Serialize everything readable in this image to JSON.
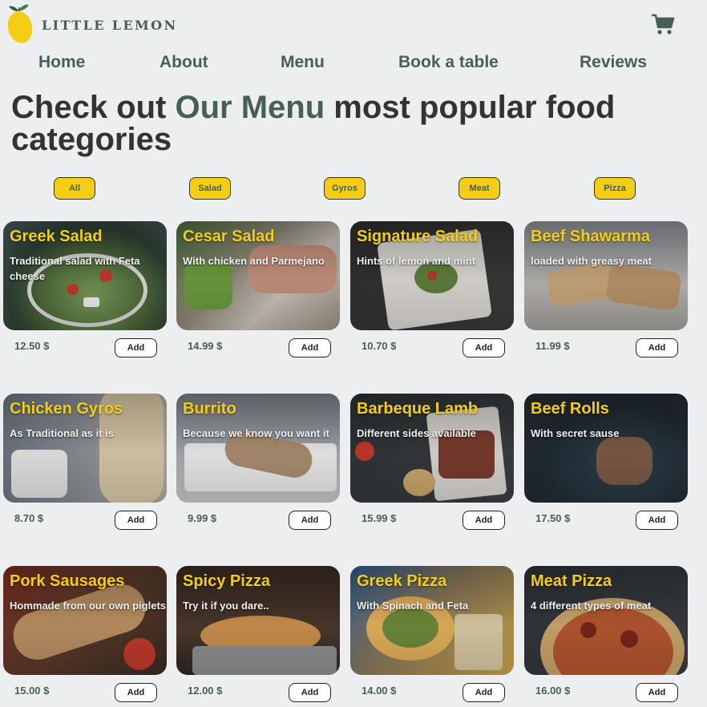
{
  "brand": {
    "name": "LITTLE LEMON"
  },
  "header": {
    "cart_icon": "cart-icon"
  },
  "nav": {
    "items": [
      "Home",
      "About",
      "Menu",
      "Book a table",
      "Reviews"
    ]
  },
  "headline": {
    "part1": "Check out ",
    "accent": "Our Menu",
    "part2": " most popular food categories"
  },
  "filters": [
    "All",
    "Salad",
    "Gyros",
    "Meat",
    "Pizza"
  ],
  "add_label": "Add",
  "colors": {
    "primary_green": "#495e57",
    "yellow": "#f4ce14",
    "background": "#edeeef"
  },
  "items": [
    {
      "title": "Greek Salad",
      "desc": "Traditional salad with Feta cheese",
      "price": "12.50 $"
    },
    {
      "title": "Cesar Salad",
      "desc": "With chicken and Parmejano",
      "price": "14.99 $"
    },
    {
      "title": "Signature Salad",
      "desc": "Hints of lemon and mint",
      "price": "10.70 $"
    },
    {
      "title": "Beef Shawarma",
      "desc": "loaded with greasy meat",
      "price": "11.99 $"
    },
    {
      "title": "Chicken Gyros",
      "desc": "As Traditional as it is",
      "price": "8.70 $"
    },
    {
      "title": "Burrito",
      "desc": "Because we know you want it",
      "price": "9.99 $"
    },
    {
      "title": "Barbeque Lamb",
      "desc": "Different sides available",
      "price": "15.99 $"
    },
    {
      "title": "Beef Rolls",
      "desc": "With secret sause",
      "price": "17.50 $"
    },
    {
      "title": "Pork Sausages",
      "desc": "Hommade from our own piglets",
      "price": "15.00 $"
    },
    {
      "title": "Spicy Pizza",
      "desc": "Try it if you dare..",
      "price": "12.00 $"
    },
    {
      "title": "Greek Pizza",
      "desc": "With Spinach and Feta",
      "price": "14.00 $"
    },
    {
      "title": "Meat Pizza",
      "desc": "4 different types of meat",
      "price": "16.00 $"
    }
  ]
}
